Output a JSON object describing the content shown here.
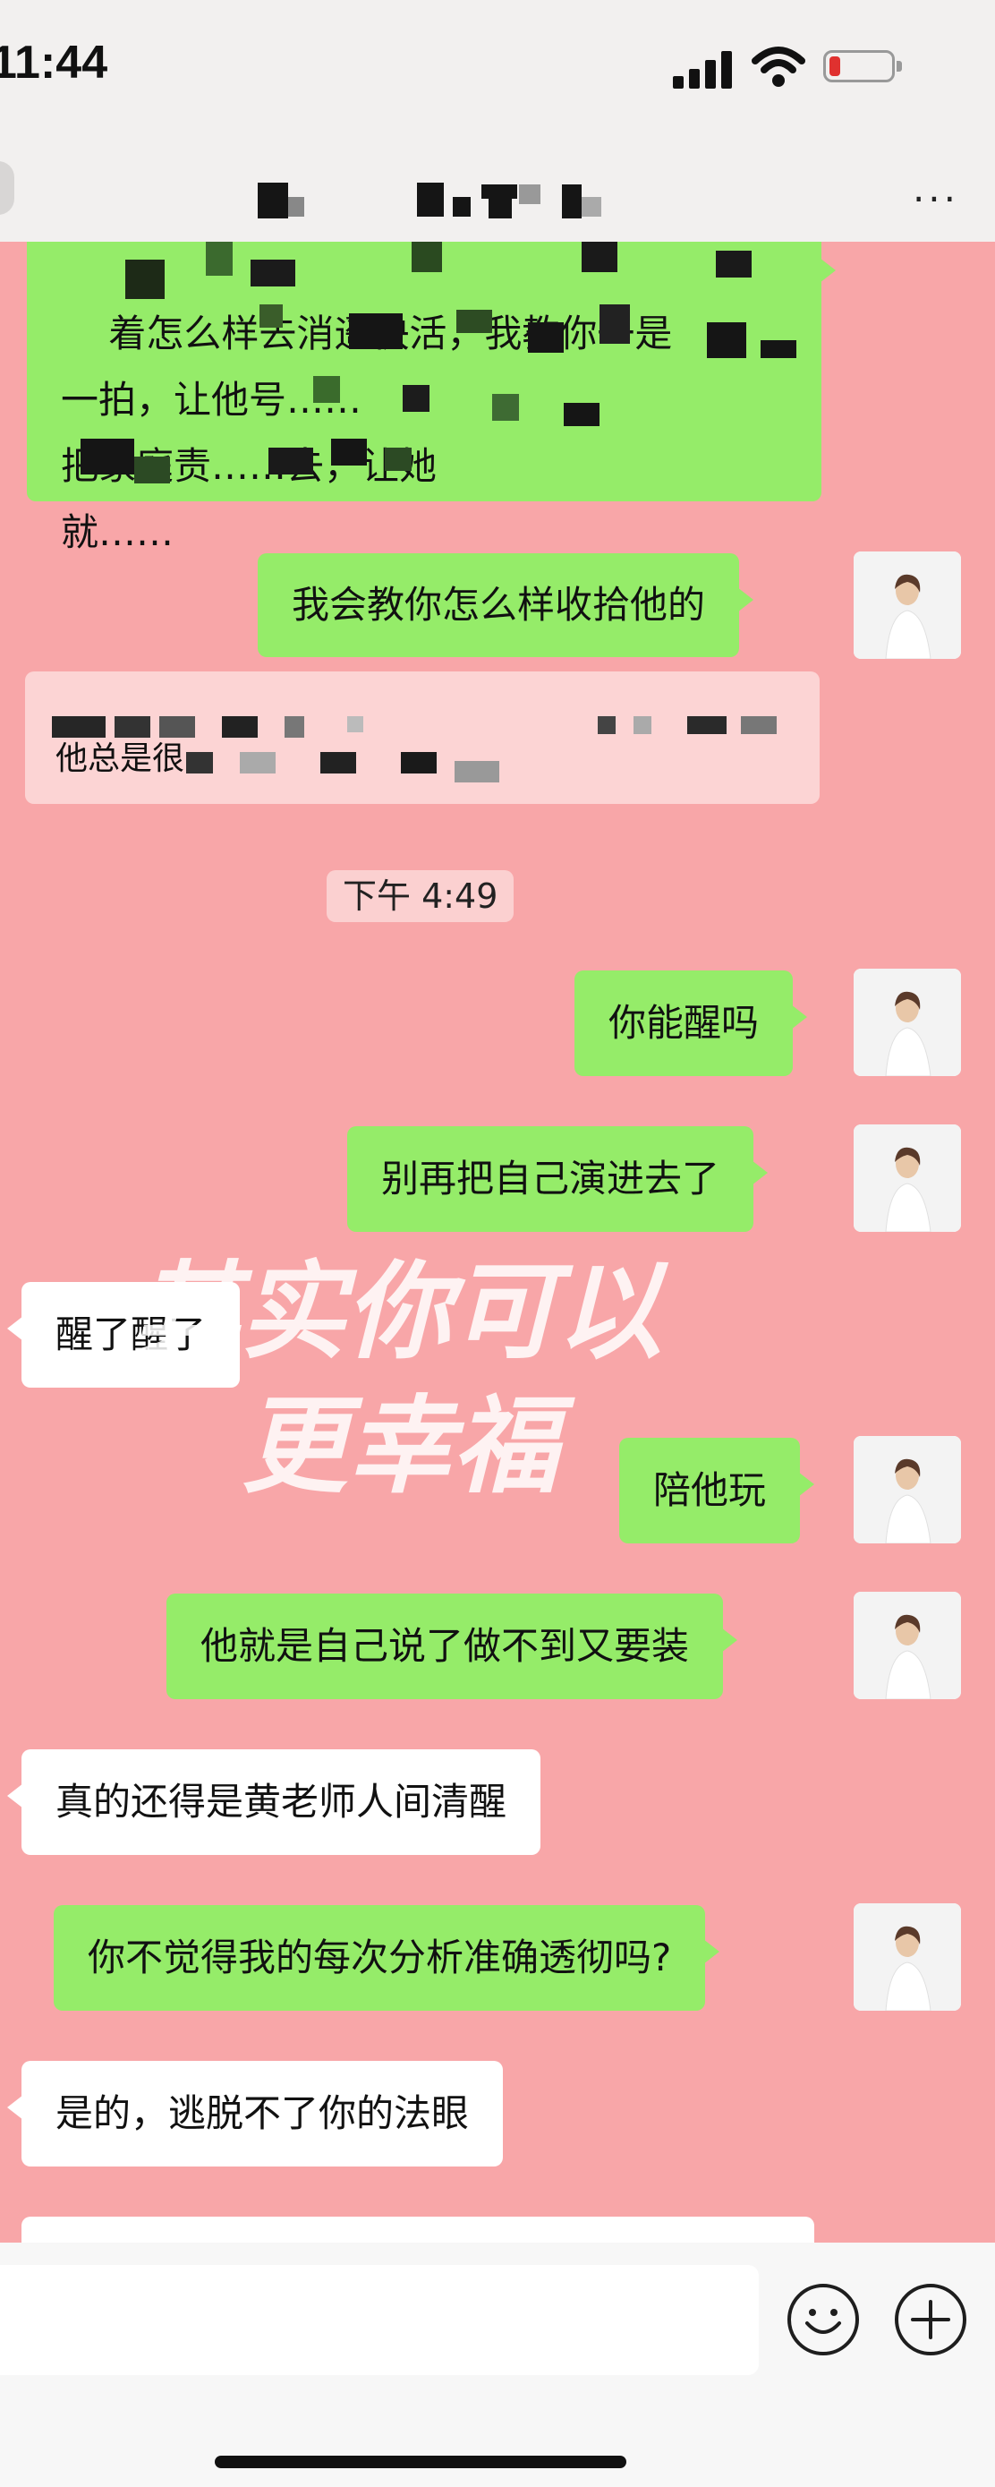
{
  "status_bar": {
    "time": "11:44"
  },
  "header": {
    "more_label": "···"
  },
  "messages": {
    "m1": "着怎么样去消遥快活，我教你一是\n一拍，让他号……\n把家庭责……去，让她\n就……",
    "m2": "我会教你怎么样收拾他的",
    "m3": "他总是很",
    "timestamp": "下午 4:49",
    "m4": "你能醒吗",
    "m5": "别再把自己演进去了",
    "m6": "醒了醒了",
    "m7": "陪他玩",
    "m8": "他就是自己说了做不到又要装",
    "m9": "真的还得是黄老师人间清醒",
    "m10": "你不觉得我的每次分析准确透彻吗?",
    "m11": "是的，逃脱不了你的法眼"
  },
  "watermark": {
    "line1": "其实你可以",
    "line2": "更幸福"
  },
  "input_bar": {
    "emoji_icon": "smiley-icon",
    "plus_icon": "plus-icon"
  },
  "colors": {
    "chat_bg": "#f8a6a8",
    "self_bubble": "#95ec69",
    "other_bubble": "#ffffff"
  }
}
